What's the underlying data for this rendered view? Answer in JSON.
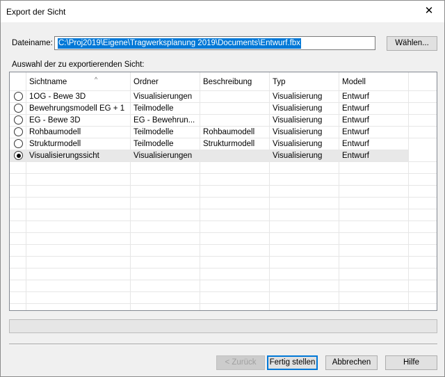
{
  "window": {
    "title": "Export der Sicht",
    "close_glyph": "✕"
  },
  "file": {
    "label": "Dateiname:",
    "value": "C:\\Proj2019\\Eigene\\Tragwerksplanung 2019\\Documents\\Entwurf.fbx",
    "browse_label": "Wählen..."
  },
  "selection_label": "Auswahl der zu exportierenden Sicht:",
  "table": {
    "sort_glyph": "^",
    "headers": [
      "Sichtname",
      "Ordner",
      "Beschreibung",
      "Typ",
      "Modell"
    ],
    "rows": [
      {
        "name": "1OG - Bewe 3D",
        "folder": "Visualisierungen",
        "description": "",
        "type": "Visualisierung",
        "model": "Entwurf",
        "selected": false
      },
      {
        "name": "Bewehrungsmodell EG + 1",
        "folder": "Teilmodelle",
        "description": "",
        "type": "Visualisierung",
        "model": "Entwurf",
        "selected": false
      },
      {
        "name": "EG - Bewe 3D",
        "folder": "EG - Bewehrun...",
        "description": "",
        "type": "Visualisierung",
        "model": "Entwurf",
        "selected": false
      },
      {
        "name": "Rohbaumodell",
        "folder": "Teilmodelle",
        "description": "Rohbaumodell",
        "type": "Visualisierung",
        "model": "Entwurf",
        "selected": false
      },
      {
        "name": "Strukturmodell",
        "folder": "Teilmodelle",
        "description": "Strukturmodell",
        "type": "Visualisierung",
        "model": "Entwurf",
        "selected": false
      },
      {
        "name": "Visualisierungssicht",
        "folder": "Visualisierungen",
        "description": "",
        "type": "Visualisierung",
        "model": "Entwurf",
        "selected": true
      }
    ]
  },
  "buttons": {
    "back": "< Zurück",
    "finish": "Fertig stellen",
    "cancel": "Abbrechen",
    "help": "Hilfe"
  }
}
